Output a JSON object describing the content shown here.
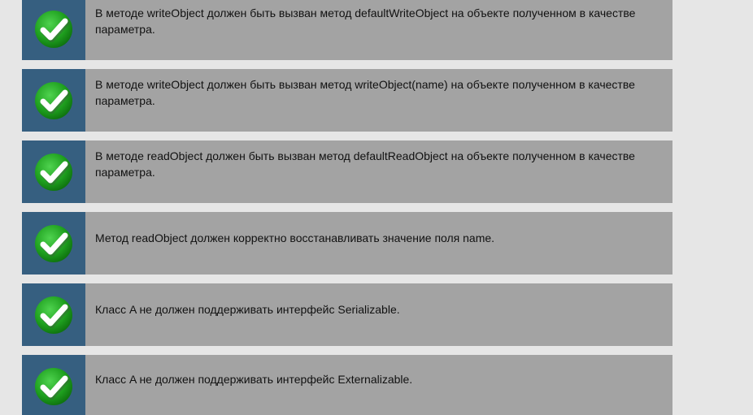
{
  "results": {
    "items": [
      {
        "status_icon": "green-checkmark-icon",
        "text": "В методе writeObject должен быть вызван метод defaultWriteObject на объекте полученном в качестве параметра."
      },
      {
        "status_icon": "green-checkmark-icon",
        "text": "В методе writeObject должен быть вызван метод writeObject(name) на объекте полученном в качестве параметра."
      },
      {
        "status_icon": "green-checkmark-icon",
        "text": "В методе readObject должен быть вызван метод defaultReadObject на объекте полученном в качестве параметра."
      },
      {
        "status_icon": "green-checkmark-icon",
        "text": "Метод readObject должен корректно восстанавливать значение поля name."
      },
      {
        "status_icon": "green-checkmark-icon",
        "text": "Класс A не должен поддерживать интерфейс Serializable."
      },
      {
        "status_icon": "green-checkmark-icon",
        "text": "Класс A не должен поддерживать интерфейс Externalizable."
      }
    ]
  },
  "colors": {
    "page_background": "#e6e6e6",
    "row_background": "#a3a3a3",
    "icon_cell_background": "#365f80",
    "check_green": "#21a821"
  }
}
